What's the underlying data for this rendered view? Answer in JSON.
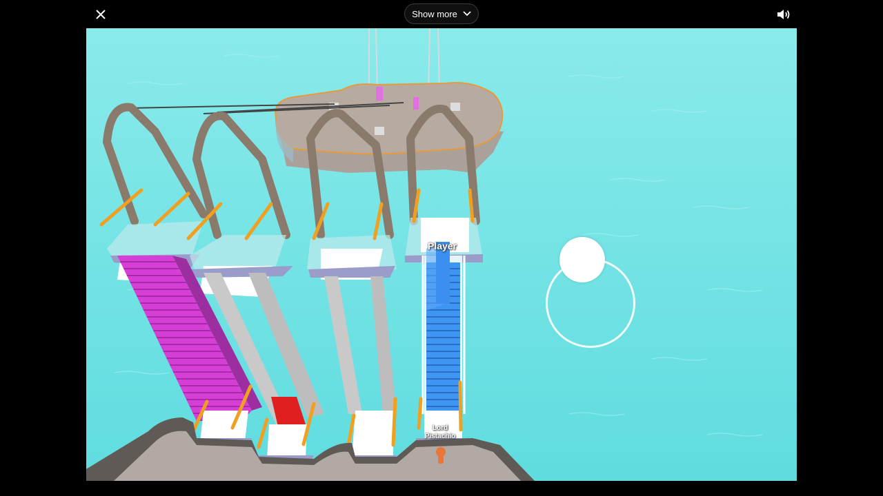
{
  "topbar": {
    "close_icon": "close-icon",
    "show_more_label": "Show more",
    "chevron_icon": "chevron-down-icon",
    "sound_icon": "volume-icon"
  },
  "game": {
    "player_label": "Player",
    "npc_label_line1": "Lord",
    "npc_label_line2": "Pistachio",
    "colors": {
      "water": "#6fe0e3",
      "platform": "#b3a9a4",
      "rail": "#8c7b6d",
      "magenta_stairs": "#d23bd1",
      "blue_stairs": "#3a8ff0",
      "red_block": "#e02020",
      "orange_handrail": "#f0a020"
    }
  }
}
